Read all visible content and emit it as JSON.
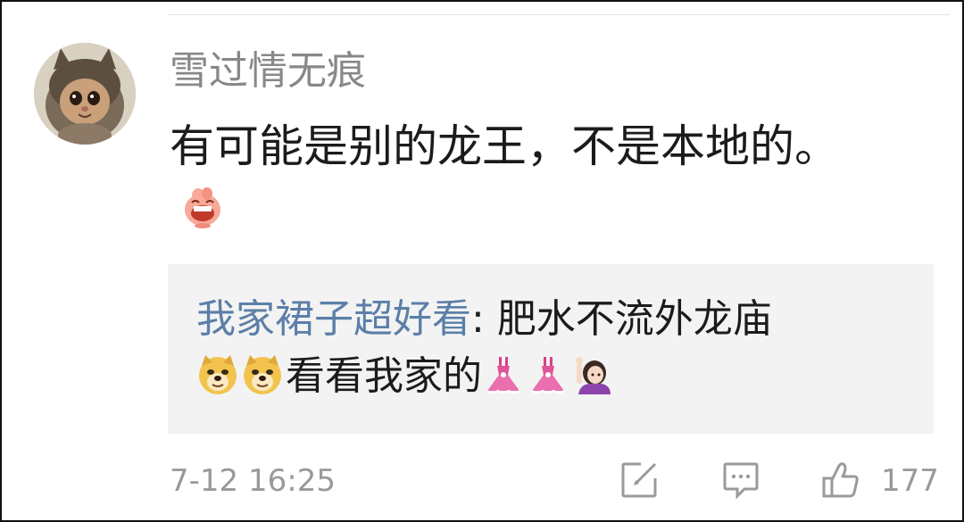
{
  "comment": {
    "username": "雪过情无痕",
    "text": "有可能是别的龙王，不是本地的。",
    "emoji": "grinning-face-emoji"
  },
  "reply": {
    "username": "我家裙子超好看",
    "separator": ": ",
    "text_part1": "肥水不流外龙庙",
    "text_part2": "看看我家的",
    "emojis": [
      "doge-emoji",
      "doge-emoji",
      "dress-emoji",
      "dress-emoji",
      "raising-hand-woman-emoji"
    ]
  },
  "footer": {
    "timestamp": "7-12 16:25",
    "like_count": "177",
    "icons": [
      "edit-icon",
      "comment-icon",
      "like-icon"
    ]
  },
  "colors": {
    "username": "#888888",
    "text": "#1b1b1b",
    "reply_username": "#5b7fa8",
    "reply_bg": "#f3f3f3",
    "meta": "#999999",
    "icon_stroke": "#9a9a9a"
  }
}
